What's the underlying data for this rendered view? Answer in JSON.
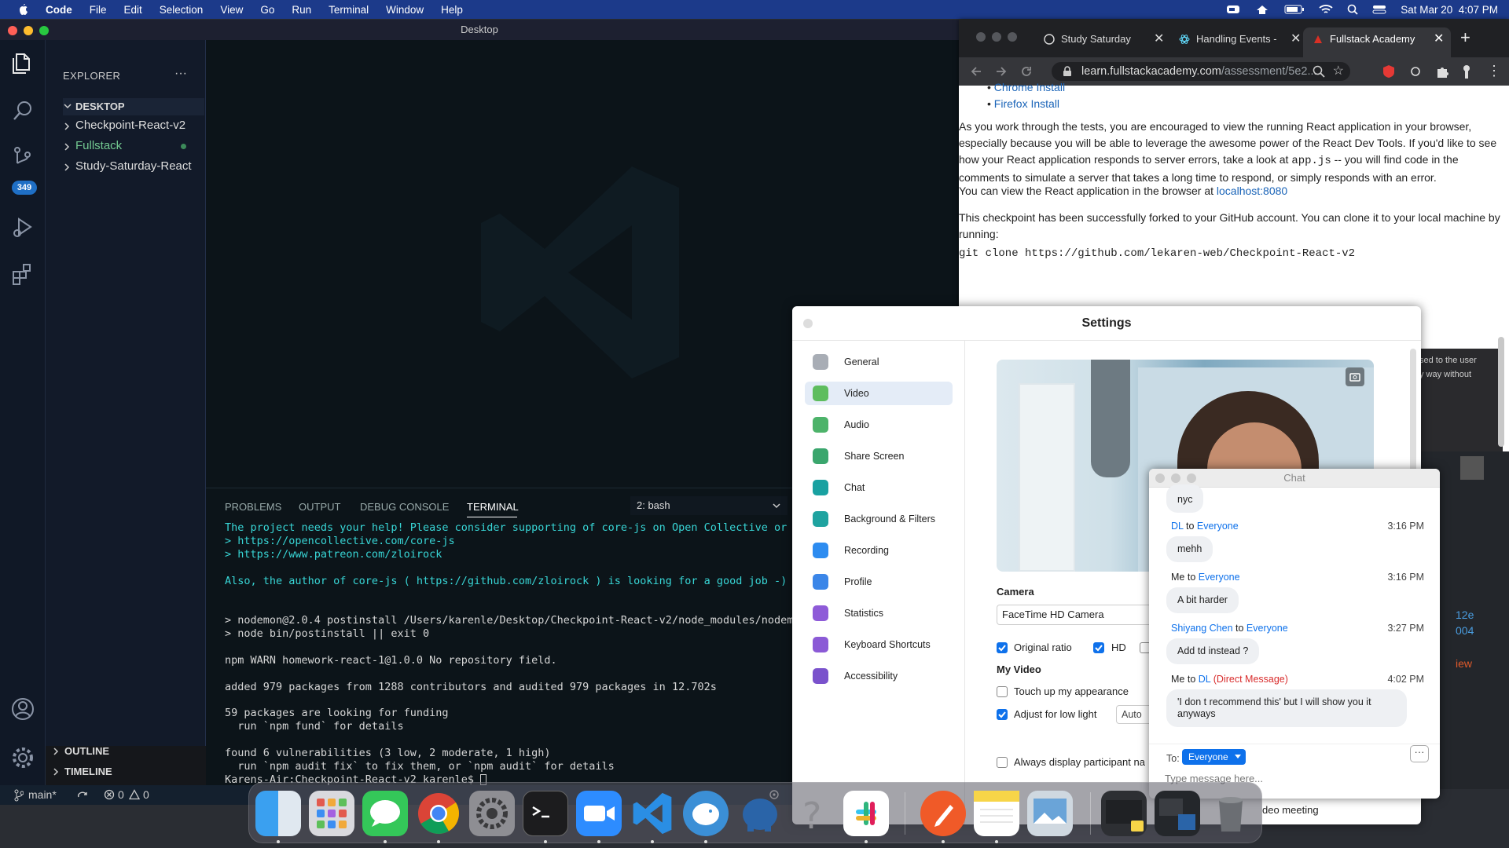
{
  "menubar": {
    "app": "Code",
    "items": [
      "File",
      "Edit",
      "Selection",
      "View",
      "Go",
      "Run",
      "Terminal",
      "Window",
      "Help"
    ],
    "datetime": "Sat Mar 20  4:07 PM"
  },
  "vscode": {
    "window_title": "Desktop",
    "source_control_badge": "349",
    "explorer": {
      "title": "EXPLORER",
      "more": "···",
      "section": "DESKTOP",
      "folders": [
        "Checkpoint-React-v2",
        "Fullstack",
        "Study-Saturday-React"
      ],
      "outline": "OUTLINE",
      "timeline": "TIMELINE"
    },
    "panel": {
      "tabs": [
        "PROBLEMS",
        "OUTPUT",
        "DEBUG CONSOLE",
        "TERMINAL"
      ],
      "active_tab": "TERMINAL",
      "terminal_select": "2: bash",
      "lines": [
        {
          "text": "The project needs your help! Please consider supporting of core-js on Open Collective or Pa",
          "color": "#38d6d6"
        },
        {
          "text": "> https://opencollective.com/core-js",
          "color": "#38d6d6"
        },
        {
          "text": "> https://www.patreon.com/zloirock",
          "color": "#38d6d6"
        },
        {
          "text": "",
          "color": "#d6d6d6"
        },
        {
          "text": "Also, the author of core-js ( https://github.com/zloirock ) is looking for a good job -)",
          "color": "#38d6d6"
        },
        {
          "text": "",
          "color": "#d6d6d6"
        },
        {
          "text": "",
          "color": "#d6d6d6"
        },
        {
          "text": "> nodemon@2.0.4 postinstall /Users/karenle/Desktop/Checkpoint-React-v2/node_modules/nodemon",
          "color": "#d6d6d6"
        },
        {
          "text": "> node bin/postinstall || exit 0",
          "color": "#d6d6d6"
        },
        {
          "text": "",
          "color": "#d6d6d6"
        },
        {
          "text": "npm WARN homework-react-1@1.0.0 No repository field.",
          "color": "#d6d6d6"
        },
        {
          "text": "",
          "color": "#d6d6d6"
        },
        {
          "text": "added 979 packages from 1288 contributors and audited 979 packages in 12.702s",
          "color": "#d6d6d6"
        },
        {
          "text": "",
          "color": "#d6d6d6"
        },
        {
          "text": "59 packages are looking for funding",
          "color": "#d6d6d6"
        },
        {
          "text": "  run `npm fund` for details",
          "color": "#d6d6d6"
        },
        {
          "text": "",
          "color": "#d6d6d6"
        },
        {
          "text": "found 6 vulnerabilities (3 low, 2 moderate, 1 high)",
          "color": "#d6d6d6"
        },
        {
          "text": "  run `npm audit fix` to fix them, or `npm audit` for details",
          "color": "#d6d6d6"
        },
        {
          "text": "Karens-Air:Checkpoint-React-v2 karenle$ ",
          "color": "#d6d6d6"
        }
      ]
    },
    "status": {
      "branch": "main*",
      "errors": "0",
      "warnings": "0"
    }
  },
  "chrome": {
    "tabs": [
      "Study Saturday",
      "Handling Events -",
      "Fullstack Academy"
    ],
    "url_host": "learn.fullstackacademy.com",
    "url_path": "/assessment/5e2...",
    "content": {
      "link1": "Chrome Install",
      "link2": "Firefox Install",
      "p1a": "As you work through the tests, you are encouraged to view the running React application in your browser, especially because you will be able to leverage the awesome power of the React Dev Tools. If you'd like to see how your React application responds to server errors, take a look at ",
      "p1code": "app.js",
      "p1b": " -- you will find code in the comments to simulate a server that takes a long time to respond, or simply responds with an error.",
      "p2a": "You can view the React application in the browser at ",
      "p2link": "localhost:8080",
      "p3": "This checkpoint has been successfully forked to your GitHub account. You can clone it to your local machine by running:",
      "clone": "git clone https://github.com/lekaren-web/Checkpoint-React-v2",
      "dark_text1": "sed to the user",
      "dark_text2": "y way without"
    }
  },
  "zoom_settings": {
    "title": "Settings",
    "sidebar": [
      "General",
      "Video",
      "Audio",
      "Share Screen",
      "Chat",
      "Background & Filters",
      "Recording",
      "Profile",
      "Statistics",
      "Keyboard Shortcuts",
      "Accessibility"
    ],
    "selected": "Video",
    "camera_label": "Camera",
    "camera_value": "FaceTime HD Camera",
    "original_ratio": "Original ratio",
    "hd": "HD",
    "my_video": "My Video",
    "touch_up": "Touch up my appearance",
    "low_light": "Adjust for low light",
    "low_light_value": "Auto",
    "always_display": "Always display participant na",
    "video_meeting": "deo meeting"
  },
  "chat": {
    "title": "Chat",
    "messages": [
      {
        "from": "",
        "to": "",
        "time": "",
        "text": "nyc"
      },
      {
        "from": "DL",
        "to": "Everyone",
        "time": "3:16 PM",
        "text": "mehh"
      },
      {
        "from": "Me",
        "to": "Everyone",
        "time": "3:16 PM",
        "text": "A bit harder"
      },
      {
        "from": "Shiyang Chen",
        "to": "Everyone",
        "time": "3:27 PM",
        "text": "Add td instead ?"
      },
      {
        "from": "Me",
        "to": "DL",
        "dm": "(Direct Message)",
        "time": "4:02 PM",
        "text": "'I don t recommend this' but I will show you it anyways"
      }
    ],
    "to_label": "To:",
    "to_value": "Everyone",
    "placeholder": "Type message here..."
  },
  "right_edge": {
    "t1": "12e",
    "t2": "004",
    "t3": "iew"
  },
  "dock": {
    "apps": [
      "finder-icon",
      "launchpad-icon",
      "messages-icon",
      "chrome-icon",
      "system-preferences-icon",
      "terminal-icon",
      "zoom-icon",
      "vscode-icon",
      "tableplus-icon",
      "postgres-elephant-icon",
      "help-icon",
      "slack-icon",
      "sketch-pen-icon",
      "notes-icon",
      "preview-icon",
      "folder-stack-icon",
      "downloads-stack-icon",
      "trash-icon"
    ]
  }
}
